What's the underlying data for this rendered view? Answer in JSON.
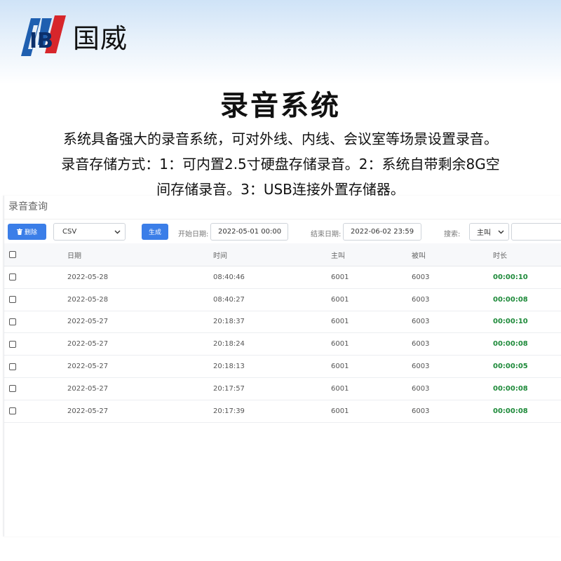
{
  "brand": {
    "logo_text": "IB",
    "name": "国威",
    "colors": {
      "blue": "#1f5fb0",
      "red": "#d7262b"
    }
  },
  "promo": {
    "title": "录音系统",
    "lines": [
      "系统具备强大的录音系统，可对外线、内线、会议室等场景设置录音。",
      "录音存储方式：1：可内置2.5寸硬盘存储录音。2：系统自带剩余8G空",
      "间存储录音。3：USB连接外置存储器。"
    ]
  },
  "app": {
    "panel_title": "录音查询",
    "toolbar": {
      "delete_label": "删除",
      "export_format": "CSV",
      "generate_label": "生成",
      "start_label": "开始日期:",
      "start_value": "2022-05-01 00:00",
      "end_label": "结束日期:",
      "end_value": "2022-06-02 23:59",
      "search_label": "搜索:",
      "search_field": "主叫",
      "search_value": ""
    },
    "columns": [
      "日期",
      "时间",
      "主叫",
      "被叫",
      "时长"
    ],
    "rows": [
      {
        "date": "2022-05-28",
        "time": "08:40:46",
        "caller": "6001",
        "callee": "6003",
        "duration": "00:00:10"
      },
      {
        "date": "2022-05-28",
        "time": "08:40:27",
        "caller": "6001",
        "callee": "6003",
        "duration": "00:00:08"
      },
      {
        "date": "2022-05-27",
        "time": "20:18:37",
        "caller": "6001",
        "callee": "6003",
        "duration": "00:00:10"
      },
      {
        "date": "2022-05-27",
        "time": "20:18:24",
        "caller": "6001",
        "callee": "6003",
        "duration": "00:00:08"
      },
      {
        "date": "2022-05-27",
        "time": "20:18:13",
        "caller": "6001",
        "callee": "6003",
        "duration": "00:00:05"
      },
      {
        "date": "2022-05-27",
        "time": "20:17:57",
        "caller": "6001",
        "callee": "6003",
        "duration": "00:00:08"
      },
      {
        "date": "2022-05-27",
        "time": "20:17:39",
        "caller": "6001",
        "callee": "6003",
        "duration": "00:00:08"
      }
    ],
    "colors": {
      "button": "#3b7ee8",
      "duration": "#1e8a3a"
    }
  }
}
